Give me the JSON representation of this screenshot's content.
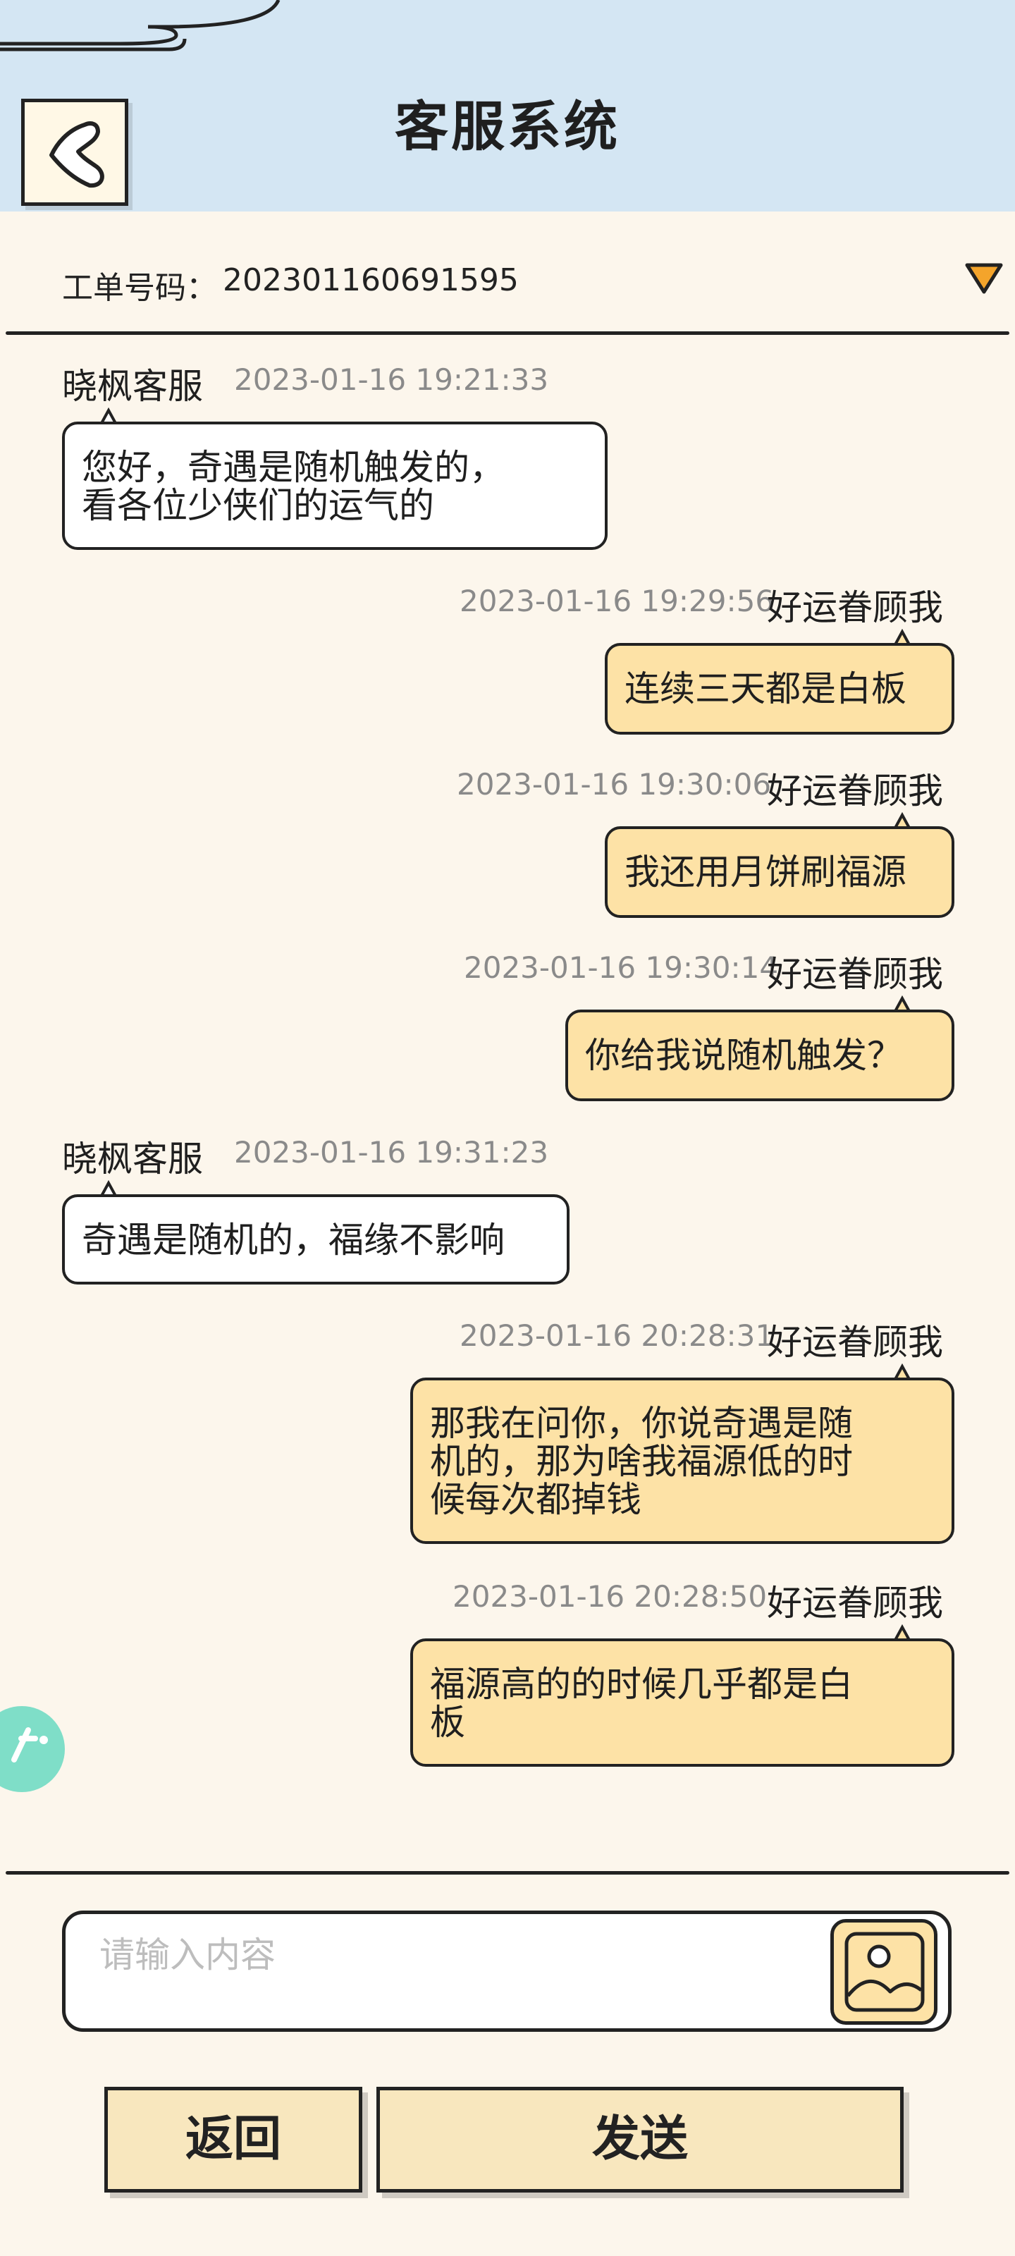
{
  "header": {
    "title": "客服系统"
  },
  "ticket": {
    "label": "工单号码：",
    "number": "202301160691595"
  },
  "messages": [
    {
      "side": "left",
      "name": "晓枫客服",
      "time": "2023-01-16 19:21:33",
      "text": [
        "您好，奇遇是随机触发的，",
        "看各位少侠们的运气的"
      ]
    },
    {
      "side": "right",
      "name": "好运眷顾我",
      "time": "2023-01-16 19:29:56",
      "text": [
        "连续三天都是白板"
      ]
    },
    {
      "side": "right",
      "name": "好运眷顾我",
      "time": "2023-01-16 19:30:06",
      "text": [
        "我还用月饼刷福源"
      ]
    },
    {
      "side": "right",
      "name": "好运眷顾我",
      "time": "2023-01-16 19:30:14",
      "text": [
        "你给我说随机触发？"
      ]
    },
    {
      "side": "left",
      "name": "晓枫客服",
      "time": "2023-01-16 19:31:23",
      "text": [
        "奇遇是随机的，福缘不影响"
      ]
    },
    {
      "side": "right",
      "name": "好运眷顾我",
      "time": "2023-01-16 20:28:31",
      "text": [
        "那我在问你，你说奇遇是随",
        "机的，那为啥我福源低的时",
        "候每次都掉钱"
      ]
    },
    {
      "side": "right",
      "name": "好运眷顾我",
      "time": "2023-01-16 20:28:50",
      "text": [
        "福源高的的时候几乎都是白",
        "板"
      ]
    }
  ],
  "input": {
    "placeholder": "请输入内容"
  },
  "buttons": {
    "back_label": "返回",
    "send_label": "发送"
  },
  "icons": {
    "back": "back-arrow-icon",
    "dropdown": "triangle-down-icon",
    "image": "image-icon"
  },
  "colors": {
    "header_bg": "#d4e6f3",
    "page_bg": "#fcf6ec",
    "right_bubble": "#fde2a6",
    "button_bg": "#f8e7be",
    "accent_float": "#7fdec8"
  }
}
